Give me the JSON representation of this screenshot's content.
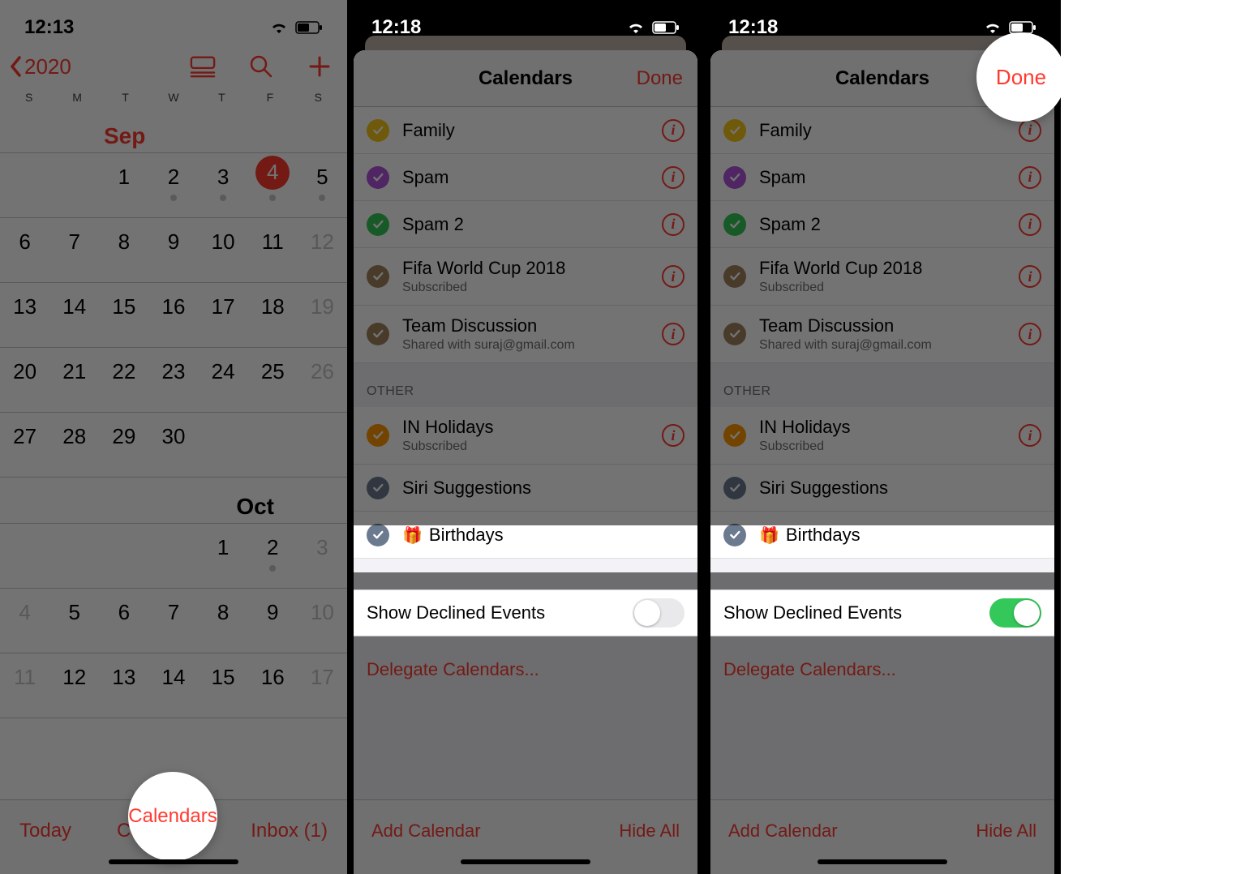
{
  "phone1": {
    "status_time": "12:13",
    "back_label": "2020",
    "weekdays": [
      "S",
      "M",
      "T",
      "W",
      "T",
      "F",
      "S"
    ],
    "month1_label": "Sep",
    "month2_label": "Oct",
    "toolbar": {
      "today": "Today",
      "calendars": "Calendars",
      "inbox": "Inbox (1)"
    },
    "sep_rows": [
      {
        "cells": [
          "",
          "",
          "1",
          "2",
          "3",
          "4",
          "5"
        ],
        "dots": [
          false,
          false,
          false,
          true,
          true,
          true,
          true
        ],
        "selected_index": 5
      },
      {
        "cells": [
          "6",
          "7",
          "8",
          "9",
          "10",
          "11",
          "12"
        ],
        "dim_last": true
      },
      {
        "cells": [
          "13",
          "14",
          "15",
          "16",
          "17",
          "18",
          "19"
        ],
        "dim_last": true
      },
      {
        "cells": [
          "20",
          "21",
          "22",
          "23",
          "24",
          "25",
          "26"
        ],
        "dim_last": true
      },
      {
        "cells": [
          "27",
          "28",
          "29",
          "30",
          "",
          "",
          ""
        ]
      }
    ],
    "oct_rows": [
      {
        "cells": [
          "",
          "",
          "",
          "",
          "1",
          "2",
          "3"
        ],
        "dots": [
          false,
          false,
          false,
          false,
          false,
          true,
          false
        ],
        "dim_last": true
      },
      {
        "cells": [
          "4",
          "5",
          "6",
          "7",
          "8",
          "9",
          "10"
        ],
        "dim_first": true,
        "dim_last": true
      },
      {
        "cells": [
          "11",
          "12",
          "13",
          "14",
          "15",
          "16",
          "17"
        ],
        "dim_first": true,
        "dim_last": true
      }
    ]
  },
  "phone2": {
    "status_time": "12:18",
    "sheet_title": "Calendars",
    "done_label": "Done",
    "calendars": [
      {
        "name": "Family",
        "color": "#f5c518"
      },
      {
        "name": "Spam",
        "color": "#af52de"
      },
      {
        "name": "Spam 2",
        "color": "#34c759"
      },
      {
        "name": "Fifa World Cup 2018",
        "sub": "Subscribed",
        "color": "#a2845e"
      },
      {
        "name": "Team Discussion",
        "sub": "Shared with suraj@gmail.com",
        "color": "#a2845e"
      }
    ],
    "other_section": "OTHER",
    "other": [
      {
        "name": "IN Holidays",
        "sub": "Subscribed",
        "color": "#ff9500",
        "info": true
      },
      {
        "name": "Siri Suggestions",
        "color": "#6b7a8f",
        "info": false
      },
      {
        "name": "Birthdays",
        "color": "#6b7a8f",
        "info": false,
        "gift": true
      }
    ],
    "show_declined_label": "Show Declined Events",
    "show_declined_on": false,
    "delegate_label": "Delegate Calendars...",
    "footer": {
      "add": "Add Calendar",
      "hide": "Hide All"
    }
  },
  "phone3": {
    "status_time": "12:18",
    "sheet_title": "Calendars",
    "done_label": "Done",
    "show_declined_on": true
  }
}
